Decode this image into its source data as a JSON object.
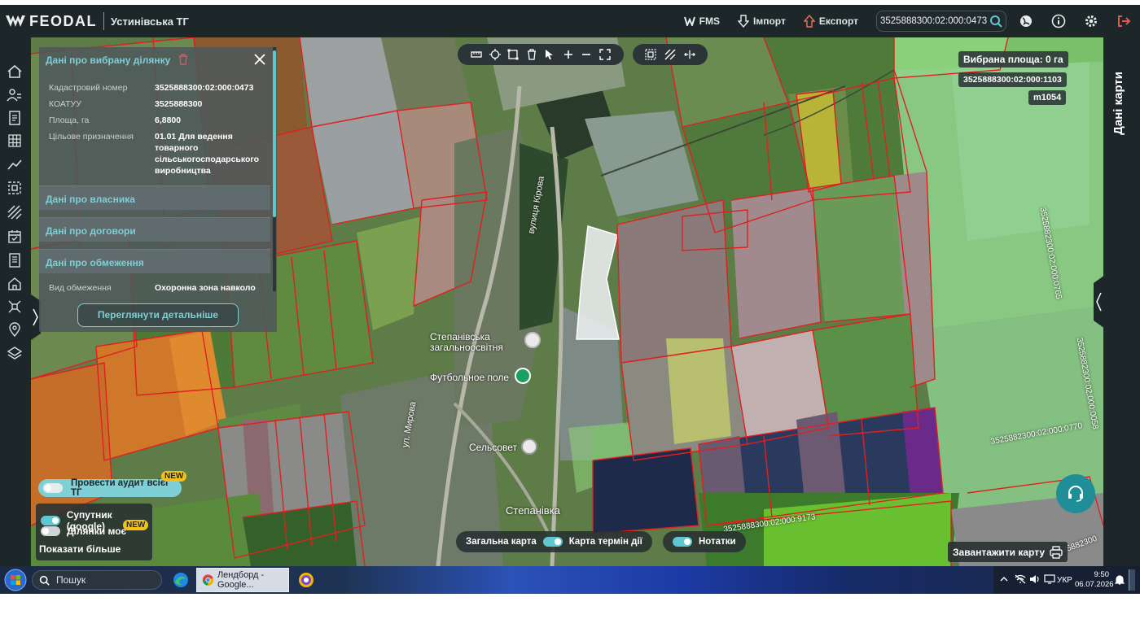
{
  "app": {
    "logo_text": "FEODAL",
    "tg_name": "Устинівська ТГ"
  },
  "topbar": {
    "fms_label": "FMS",
    "import_label": "Імпорт",
    "export_label": "Експорт",
    "search_value": "3525888300:02:000:0473"
  },
  "panel": {
    "title": "Дані про вибрану ділянку",
    "rows": [
      {
        "key": "Кадастровий номер",
        "value": "3525888300:02:000:0473"
      },
      {
        "key": "КОАТУУ",
        "value": "3525888300"
      },
      {
        "key": "Площа, га",
        "value": "6,8800"
      },
      {
        "key": "Цільове призначення",
        "value": "01.01 Для ведення товарного сільськогосподарського виробництва"
      }
    ],
    "sections": [
      "Дані про власника",
      "Дані про договори",
      "Дані про обмеження"
    ],
    "restriction_key": "Вид обмеження",
    "restriction_value": "Охоронна зона навколо",
    "details_button": "Переглянути детальніше"
  },
  "right_panel_title": "Дані карти",
  "map_tags": {
    "selected_area": "Вибрана площа: 0 га",
    "parcel": "3525888300:02:000:1103",
    "m_code": "m1054"
  },
  "map_labels": {
    "street1": "вулиця Кірова",
    "street2": "ул. Мирова",
    "school": "Степанівська загальноосвітня",
    "football": "Футбольное поле",
    "council": "Сельсовет",
    "village": "Степанівка",
    "cad1": "3525882300:02:000:0765",
    "cad2": "3525882300:02:000:0770",
    "cad3": "3525888300:02:000:9173",
    "cad4": "3525882300:02:000:0058",
    "cad5": "3525882300"
  },
  "audit": {
    "label": "Провести аудит всієї ТГ",
    "badge": "NEW"
  },
  "layers": {
    "satellite": "Супутник (google)",
    "moe": "Ділянки моє",
    "moe_badge": "NEW",
    "more": "Показати більше"
  },
  "bottom": {
    "general_map": "Загальна карта",
    "term_map": "Карта термін дії",
    "notes": "Нотатки",
    "download": "Завантажити карту"
  },
  "taskbar": {
    "search": "Пошук",
    "app_title": "Лендборд - Google...",
    "lang": "УКР",
    "time": "9:50",
    "date": "06.07.2026"
  }
}
